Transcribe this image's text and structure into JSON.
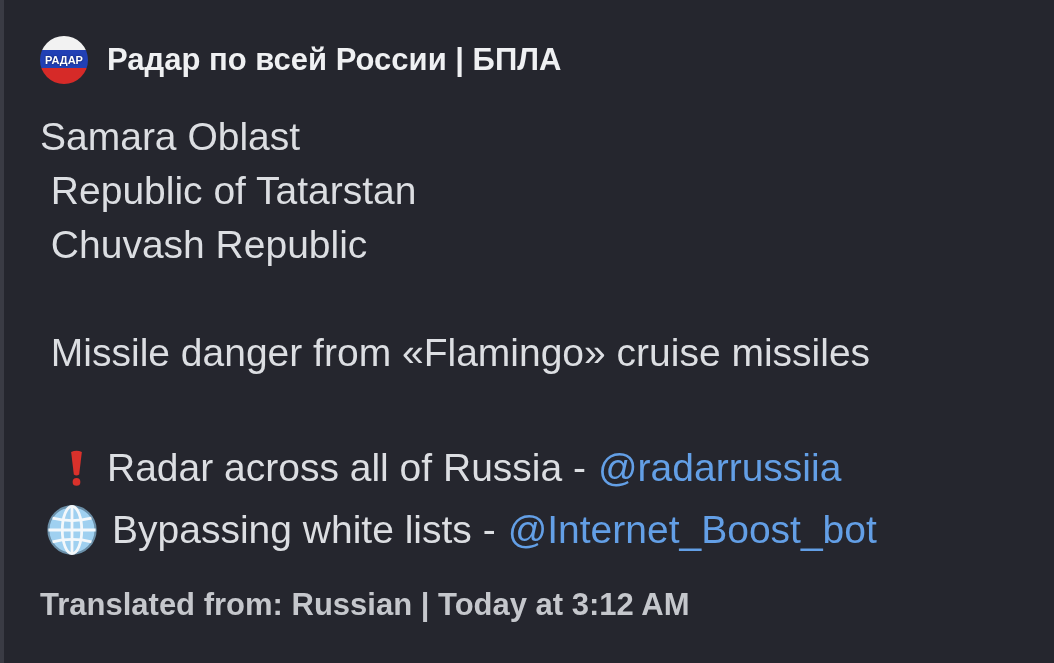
{
  "message": {
    "avatar": {
      "label": "РАДАР"
    },
    "author": "Радар по всей России | БПЛА",
    "lines": [
      {
        "kind": "text",
        "text": "Samara Oblast"
      },
      {
        "kind": "text",
        "text": " Republic of Tatarstan"
      },
      {
        "kind": "text",
        "text": " Chuvash Republic"
      },
      {
        "kind": "blank"
      },
      {
        "kind": "text",
        "text": " Missile danger from «Flamingo» cruise missiles"
      },
      {
        "kind": "blank"
      },
      {
        "kind": "exclamation",
        "text": "Radar across all of Russia -",
        "link": "@radarrussiia"
      },
      {
        "kind": "globe",
        "text": "Bypassing white lists -",
        "link": "@Internet_Boost_bot"
      }
    ],
    "footer": "Translated from: Russian | Today at 3:12 AM"
  }
}
